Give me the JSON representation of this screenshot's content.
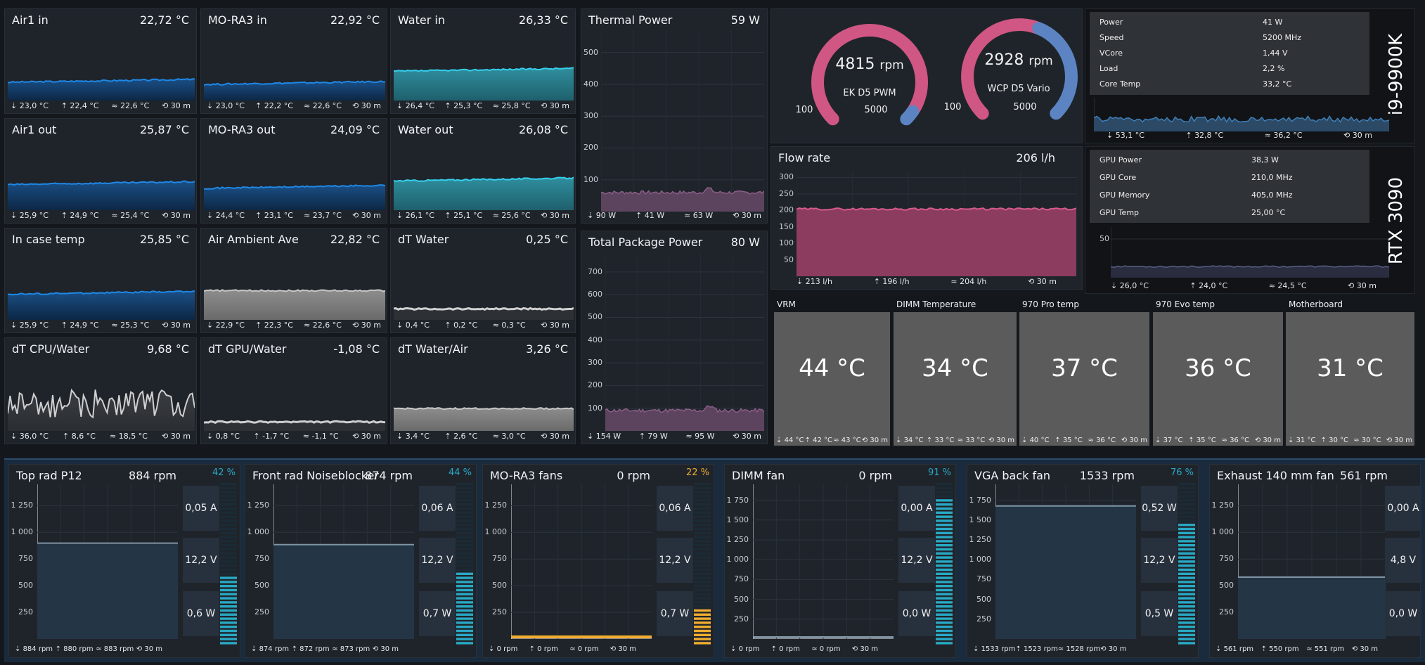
{
  "colors": {
    "background": "#14181d",
    "panel": "#1f242b",
    "blue": "#1f7fd6",
    "cyan": "#2ec8e6",
    "gray": "#a8a8a8",
    "pink": "#d05683",
    "slate": "#5c84c2",
    "purple": "#6a4a69",
    "orange": "#f0ad2f",
    "fanbar": "#29a9c4"
  },
  "temps": [
    {
      "title": "Air1 in",
      "value": "22,72 °C",
      "style": "blue",
      "level": 0.25,
      "min": "23,0 °C",
      "max": "22,4 °C",
      "avg": "22,6 °C",
      "time": "30 m"
    },
    {
      "title": "MO-RA3 in",
      "value": "22,92 °C",
      "style": "blue",
      "level": 0.22,
      "min": "23,0 °C",
      "max": "22,2 °C",
      "avg": "22,6 °C",
      "time": "30 m"
    },
    {
      "title": "Water in",
      "value": "26,33 °C",
      "style": "cyan",
      "level": 0.4,
      "min": "26,4 °C",
      "max": "25,3 °C",
      "avg": "25,8 °C",
      "time": "30 m"
    },
    {
      "title": "Air1 out",
      "value": "25,87 °C",
      "style": "blue",
      "level": 0.35,
      "min": "25,9 °C",
      "max": "24,9 °C",
      "avg": "25,4 °C",
      "time": "30 m"
    },
    {
      "title": "MO-RA3 out",
      "value": "24,09 °C",
      "style": "blue",
      "level": 0.3,
      "min": "24,4 °C",
      "max": "23,1 °C",
      "avg": "23,7 °C",
      "time": "30 m"
    },
    {
      "title": "Water out",
      "value": "26,08 °C",
      "style": "cyan",
      "level": 0.4,
      "min": "26,1 °C",
      "max": "25,1 °C",
      "avg": "25,6 °C",
      "time": "30 m"
    },
    {
      "title": "In case temp",
      "value": "25,85 °C",
      "style": "blue",
      "level": 0.35,
      "min": "25,9 °C",
      "max": "24,9 °C",
      "avg": "25,3 °C",
      "time": "30 m"
    },
    {
      "title": "Air Ambient Ave",
      "value": "22,82 °C",
      "style": "gray",
      "level": 0.4,
      "min": "22,9 °C",
      "max": "22,3 °C",
      "avg": "22,6 °C",
      "time": "30 m"
    },
    {
      "title": "dT Water",
      "value": "0,25 °C",
      "style": "grayline",
      "level": 0.15,
      "min": "0,4 °C",
      "max": "0,2 °C",
      "avg": "0,3 °C",
      "time": "30 m"
    },
    {
      "title": "dT CPU/Water",
      "value": "9,68 °C",
      "style": "spiky",
      "level": 0.5,
      "min": "36,0 °C",
      "max": "8,6 °C",
      "avg": "18,5 °C",
      "time": "30 m"
    },
    {
      "title": "dT GPU/Water",
      "value": "-1,08 °C",
      "style": "grayline",
      "level": 0.12,
      "min": "0,8 °C",
      "max": "-1,7 °C",
      "avg": "-1,1 °C",
      "time": "30 m"
    },
    {
      "title": "dT Water/Air",
      "value": "3,26 °C",
      "style": "gray",
      "level": 0.3,
      "min": "3,4 °C",
      "max": "2,6 °C",
      "avg": "3,0 °C",
      "time": "30 m"
    }
  ],
  "thermal_power": {
    "title": "Thermal Power",
    "value": "59 W",
    "ticks": [
      "500",
      "400",
      "300",
      "200",
      "100"
    ],
    "min": "90 W",
    "max": "41 W",
    "avg": "63 W",
    "time": "30 m"
  },
  "package_power": {
    "title": "Total Package Power",
    "value": "80 W",
    "ticks": [
      "700",
      "600",
      "500",
      "400",
      "300",
      "200",
      "100"
    ],
    "min": "154 W",
    "max": "79 W",
    "avg": "95 W",
    "time": "30 m"
  },
  "pumps": [
    {
      "value": "4815",
      "unit": "rpm",
      "name": "EK D5 PWM",
      "min_label": "100",
      "max_label": "5000",
      "level": 0.96,
      "color": "#d05683"
    },
    {
      "value": "2928",
      "unit": "rpm",
      "name": "WCP D5 Vario",
      "min_label": "100",
      "max_label": "5000",
      "level": 0.58,
      "color": "#d05683"
    }
  ],
  "flow": {
    "title": "Flow rate",
    "value": "206 l/h",
    "ticks": [
      "300",
      "250",
      "200",
      "150",
      "100",
      "50"
    ],
    "min": "213 l/h",
    "max": "196 l/h",
    "avg": "204 l/h",
    "time": "30 m"
  },
  "cpu": {
    "name": "i9-9900K",
    "rows": [
      [
        "Power",
        "41 W"
      ],
      [
        "Speed",
        "5200 MHz"
      ],
      [
        "VCore",
        "1,44 V"
      ],
      [
        "Load",
        "2,2 %"
      ],
      [
        "Core Temp",
        "33,2 °C"
      ]
    ],
    "min": "53,1 °C",
    "max": "32,8 °C",
    "avg": "36,2 °C",
    "time": "30 m"
  },
  "gpu": {
    "name": "RTX 3090",
    "rows": [
      [
        "GPU Power",
        "38,3 W"
      ],
      [
        "GPU Core",
        "210,0 MHz"
      ],
      [
        "GPU Memory",
        "405,0 MHz"
      ],
      [
        "GPU Temp",
        "25,00 °C"
      ]
    ],
    "tick": "50",
    "min": "26,0 °C",
    "max": "24,0 °C",
    "avg": "24,5 °C",
    "time": "30 m"
  },
  "tiles": [
    {
      "title": "VRM",
      "value": "44 °C",
      "min": "44 °C",
      "max": "42 °C",
      "avg": "43 °C",
      "time": "30 m"
    },
    {
      "title": "DIMM Temperature",
      "value": "34 °C",
      "min": "34 °C",
      "max": "33 °C",
      "avg": "33 °C",
      "time": "30 m"
    },
    {
      "title": "970 Pro temp",
      "value": "37 °C",
      "min": "40 °C",
      "max": "35 °C",
      "avg": "36 °C",
      "time": "30 m"
    },
    {
      "title": "970 Evo temp",
      "value": "36 °C",
      "min": "37 °C",
      "max": "35 °C",
      "avg": "36 °C",
      "time": "30 m"
    },
    {
      "title": "Motherboard",
      "value": "31 °C",
      "min": "31 °C",
      "max": "30 °C",
      "avg": "30 °C",
      "time": "30 m"
    }
  ],
  "fans": [
    {
      "title": "Top rad P12",
      "rpm": "884 rpm",
      "percent": "42 %",
      "pct": 0.42,
      "pctcolor": "#29a9c4",
      "ticks": [
        "1 250",
        "1 000",
        "750",
        "500",
        "250"
      ],
      "level": 0.62,
      "current": "0,05 A",
      "voltage": "12,2 V",
      "power": "0,6 W",
      "min": "884 rpm",
      "max": "880 rpm",
      "avg": "883 rpm",
      "time": "30 m",
      "style": "normal"
    },
    {
      "title": "Front rad Noiseblocker",
      "rpm": "874 rpm",
      "percent": "44 %",
      "pct": 0.44,
      "pctcolor": "#29a9c4",
      "ticks": [
        "1 250",
        "1 000",
        "750",
        "500",
        "250"
      ],
      "level": 0.61,
      "current": "0,06 A",
      "voltage": "12,2 V",
      "power": "0,7 W",
      "min": "874 rpm",
      "max": "872 rpm",
      "avg": "873 rpm",
      "time": "30 m",
      "style": "normal"
    },
    {
      "title": "MO-RA3 fans",
      "rpm": "0 rpm",
      "percent": "22 %",
      "pct": 0.22,
      "pctcolor": "#f0ad2f",
      "ticks": [
        "1 250",
        "1 000",
        "750",
        "500",
        "250"
      ],
      "level": 0.0,
      "current": "0,06 A",
      "voltage": "12,2 V",
      "power": "0,7 W",
      "min": "0 rpm",
      "max": "0 rpm",
      "avg": "0 rpm",
      "time": "30 m",
      "style": "orange"
    },
    {
      "title": "DIMM fan",
      "rpm": "0 rpm",
      "percent": "91 %",
      "pct": 0.91,
      "pctcolor": "#29a9c4",
      "ticks": [
        "1 750",
        "1 500",
        "1 250",
        "1 000",
        "750",
        "500",
        "250"
      ],
      "level": 0.0,
      "current": "0,00 A",
      "voltage": "12,2 V",
      "power": "0,0 W",
      "min": "0 rpm",
      "max": "0 rpm",
      "avg": "0 rpm",
      "time": "30 m",
      "style": "normal"
    },
    {
      "title": "VGA back fan",
      "rpm": "1533 rpm",
      "percent": "76 %",
      "pct": 0.76,
      "pctcolor": "#29a9c4",
      "ticks": [
        "1 750",
        "1 500",
        "1 250",
        "1 000",
        "750",
        "500",
        "250"
      ],
      "level": 0.86,
      "current": "0,52 W",
      "voltage": "12,2 V",
      "power": "0,5 W",
      "min": "1533 rpm",
      "max": "1523 rpm",
      "avg": "1528 rpm",
      "time": "30 m",
      "style": "normal"
    },
    {
      "title": "Exhaust 140 mm fan",
      "rpm": "561 rpm",
      "percent": "",
      "pct": 0,
      "pctcolor": "#29a9c4",
      "ticks": [
        "1 250",
        "1 000",
        "750",
        "500",
        "250"
      ],
      "level": 0.4,
      "current": "0,00 A",
      "voltage": "4,8 V",
      "power": "0,0 W",
      "min": "561 rpm",
      "max": "550 rpm",
      "avg": "551 rpm",
      "time": "30 m",
      "style": "normal"
    }
  ]
}
